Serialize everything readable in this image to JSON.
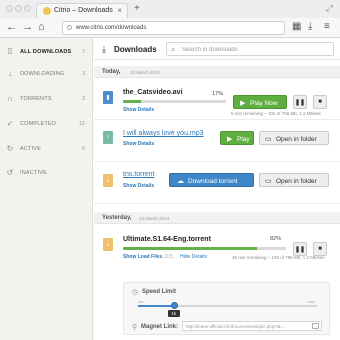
{
  "browser": {
    "tab_title": "Citrio – Downloads",
    "url": "www.citrio.com/downloads"
  },
  "sidebar": {
    "items": [
      {
        "label": "ALL DOWNLOADS",
        "count": "7"
      },
      {
        "label": "DOWNLOADING",
        "count": "3"
      },
      {
        "label": "TORRENTS",
        "count": "3"
      },
      {
        "label": "COMPLETED",
        "count": "12"
      },
      {
        "label": "ACTIVE",
        "count": "6"
      },
      {
        "label": "INACTIVE",
        "count": ""
      }
    ]
  },
  "header": {
    "title": "Downloads",
    "search_placeholder": "Search in downloads"
  },
  "groups": [
    {
      "label": "Today,",
      "date": "13 March 2014"
    },
    {
      "label": "Yesterday,",
      "date": "12 March 2014"
    }
  ],
  "downloads": [
    {
      "name": "the_Catsvideo.avi",
      "show_details": "Show Details",
      "percent": "17%",
      "progress": 0.17,
      "remaining": "5 min remaining  –  100 of 756 Mb, 1.2 Mb/sec",
      "button": "Play Now"
    },
    {
      "name": "I will always love you.mp3",
      "show_details": "Show Details",
      "button": "Play",
      "secondary": "Open in folder"
    },
    {
      "name": "tns.torrent",
      "show_details": "Show Details",
      "button": "Download torrent",
      "secondary": "Open in folder"
    },
    {
      "name": "Ultimate.S1.64-Eng.torrent",
      "show_details": "Show Load Files",
      "file_count": "(23)",
      "hide_details": "Hide Details",
      "percent": "82%",
      "progress": 0.82,
      "remaining": "45 min remaining  –  100 of 756 Mb, 1.2 Mb/sec"
    }
  ],
  "details": {
    "speed_label": "Speed Limit",
    "min_label": "min",
    "max_label": "max",
    "slider_value": "1k",
    "slider_level": 0.2,
    "magnet_label": "Magnet Link:",
    "magnet_url": "http://leave-official.info/forums/viewtopic.php?id=..."
  },
  "colors": {
    "accent_green": "#5eae42",
    "accent_blue": "#3f87c8",
    "link": "#2a78b8"
  }
}
